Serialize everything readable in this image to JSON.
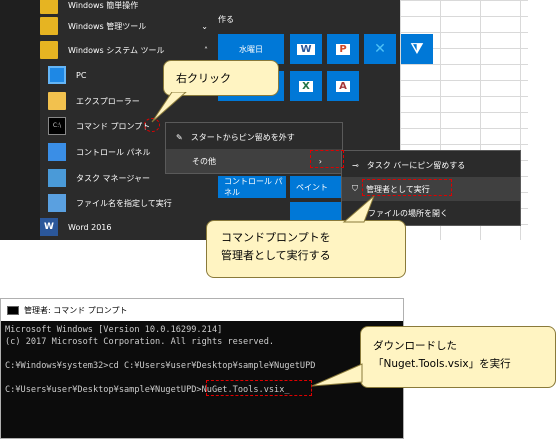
{
  "start_menu": {
    "apps": [
      {
        "label": "Windows 簡単操作",
        "type": "folder"
      },
      {
        "label": "Windows 管理ツール",
        "type": "folder"
      },
      {
        "label": "Windows システム ツール",
        "type": "folder",
        "expanded": true
      },
      {
        "label": "PC",
        "type": "pc"
      },
      {
        "label": "エクスプローラー",
        "type": "explorer"
      },
      {
        "label": "コマンド プロンプト",
        "type": "cmd"
      },
      {
        "label": "コントロール パネル",
        "type": "control"
      },
      {
        "label": "タスク マネージャー",
        "type": "taskmgr"
      },
      {
        "label": "ファイル名を指定して実行",
        "type": "run"
      },
      {
        "label": "Word 2016",
        "type": "word"
      }
    ],
    "group_label": "作る",
    "calendar_tile": "水曜日",
    "tile_control_panel": "コントロール パネル",
    "tile_paint": "ペイント"
  },
  "context_menu": {
    "items": [
      "スタートからピン留めを外す",
      "その他"
    ]
  },
  "submenu": {
    "items": [
      "タスク バーにピン留めする",
      "管理者として実行",
      "ファイルの場所を開く"
    ]
  },
  "callouts": {
    "right_click": "右クリック",
    "run_as_admin_line1": "コマンドプロンプトを",
    "run_as_admin_line2": "管理者として実行する",
    "download_line1": "ダウンロードした",
    "download_line2": "「Nuget.Tools.vsix」を実行"
  },
  "console": {
    "title": "管理者: コマンド プロンプト",
    "lines": [
      "Microsoft Windows [Version 10.0.16299.214]",
      "(c) 2017 Microsoft Corporation. All rights reserved.",
      "",
      "C:¥Windows¥system32>cd C:¥Users¥user¥Desktop¥sample¥NugetUPD",
      "",
      "C:¥Users¥user¥Desktop¥sample¥NugetUPD>NuGet.Tools.vsix_"
    ]
  },
  "colors": {
    "accent": "#0078d7",
    "callout_fill": "#fff4c2",
    "highlight_dash": "#e00000"
  }
}
